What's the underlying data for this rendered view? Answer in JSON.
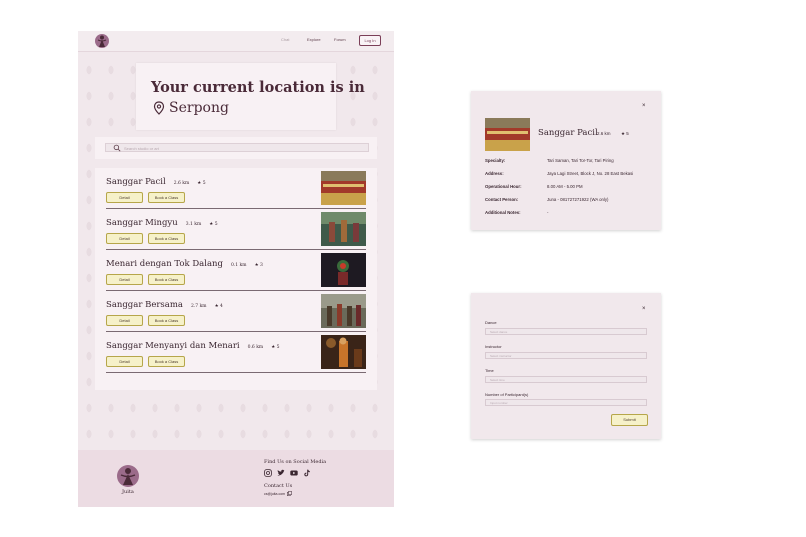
{
  "nav": {
    "links": [
      "Chat",
      "Explore",
      "Forum"
    ],
    "login_label": "Log In"
  },
  "location": {
    "title": "Your current location is in",
    "city": "Serpong"
  },
  "search": {
    "placeholder": "Search studio or art"
  },
  "studios": [
    {
      "name": "Sanggar Pacil",
      "distance": "2.6 km",
      "rating": "★ 5",
      "detail_label": "Detail",
      "book_label": "Book a Class"
    },
    {
      "name": "Sanggar Mingyu",
      "distance": "3.1 km",
      "rating": "★ 5",
      "detail_label": "Detail",
      "book_label": "Book a Class"
    },
    {
      "name": "Menari dengan Tok Dalang",
      "distance": "0.1 km",
      "rating": "★ 3",
      "detail_label": "Detail",
      "book_label": "Book a Class"
    },
    {
      "name": "Sanggar Bersama",
      "distance": "2.7 km",
      "rating": "★ 4",
      "detail_label": "Detail",
      "book_label": "Book a Class"
    },
    {
      "name": "Sanggar Menyanyi dan Menari",
      "distance": "0.6 km",
      "rating": "★ 5",
      "detail_label": "Detail",
      "book_label": "Book a Class"
    }
  ],
  "footer": {
    "brand": "Juita",
    "social_title": "Find Us on Social Media",
    "social_icons": [
      "instagram-icon",
      "twitter-icon",
      "youtube-icon",
      "tiktok-icon"
    ],
    "contact_title": "Contact Us",
    "email": "cs@juita.com"
  },
  "detail_modal": {
    "close": "×",
    "name": "Sanggar Pacil",
    "distance": "2.6 km",
    "rating": "★ 5",
    "fields": [
      {
        "label": "Specialty:",
        "value": "Tari Saman, Tari Tor-Tor, Tari Piring"
      },
      {
        "label": "Address:",
        "value": "Jaya Lagi Street, Block J, No. 28 East Bekasi"
      },
      {
        "label": "Operational Hour:",
        "value": "8.00 AM - 5.00 PM"
      },
      {
        "label": "Contact Person:",
        "value": "Juna - 081727271922 (WA only)"
      },
      {
        "label": "Additional Notes:",
        "value": "-"
      }
    ]
  },
  "booking_modal": {
    "close": "×",
    "fields": [
      {
        "label": "Dance",
        "placeholder": "Select dance"
      },
      {
        "label": "Instructor",
        "placeholder": "Select instructor"
      },
      {
        "label": "Time",
        "placeholder": "Select time"
      },
      {
        "label": "Number of Participant(s)",
        "placeholder": "Input number"
      }
    ],
    "submit_label": "Submit"
  },
  "colors": {
    "accent": "#7b3f58",
    "button_fill": "#f6f1c9",
    "page_background": "#f1e8ec",
    "footer_background": "#ecdce3"
  }
}
